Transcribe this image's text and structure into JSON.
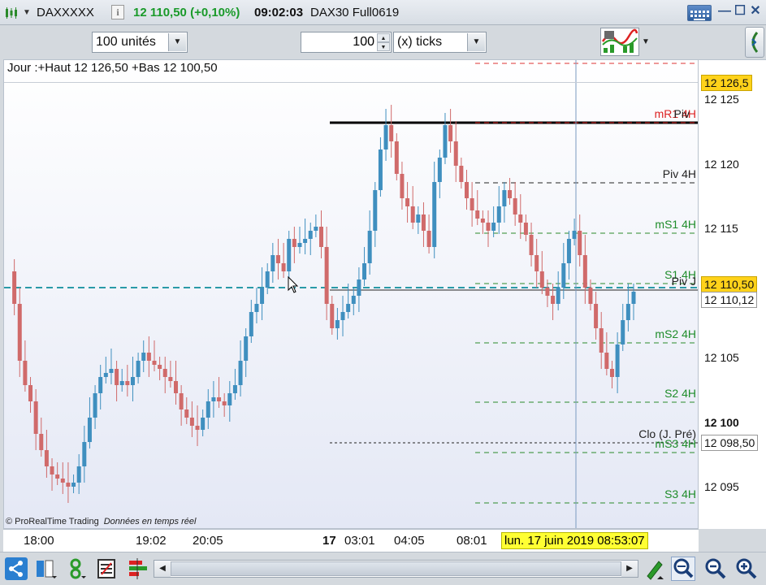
{
  "titlebar": {
    "symbol": "DAXXXXX",
    "info_label": "i",
    "price_change": "12 110,50 (+0,10%)",
    "time": "09:02:03",
    "instrument": "DAX30 Full0619",
    "minimize": "—",
    "maximize": "☐",
    "close": "✕"
  },
  "toolbar": {
    "units_select": "100 unités",
    "quantity": "100",
    "ticks_select": "(x) ticks"
  },
  "chart": {
    "header": "Jour :+Haut 12 126,50 +Bas 12 100,50",
    "credit_brand": "© ProRealTime Trading",
    "credit_note": "Données en temps réel",
    "levels": {
      "mr1": "mR1 4H",
      "piv": "Piv",
      "piv4h": "Piv 4H",
      "ms1": "mS1 4H",
      "s1": "S1 4H",
      "piv_j": "Piv J",
      "ms2": "mS2 4H",
      "s2": "S2 4H",
      "clo": "Clo (J. Pré)",
      "ms3": "mS3 4H",
      "s3": "S3 4H"
    },
    "colors": {
      "up": "#3f8fbf",
      "down": "#d06a6a",
      "green_level": "#1e8c2a",
      "red_level": "#dd2222"
    }
  },
  "yaxis": {
    "ticks": [
      "12 125",
      "12 120",
      "12 115",
      "12 105",
      "12 095"
    ],
    "bold_tick": "12 100",
    "high_tag": "12 126,5",
    "last_tag": "12 110,50",
    "cursor_tag": "12 110,12",
    "close_tag": "12 098,50"
  },
  "xaxis": {
    "ticks": [
      "18:00",
      "19:02",
      "20:05",
      "03:01",
      "04:05",
      "08:01"
    ],
    "day": "17",
    "cursor_label": "lun. 17 juin 2019 08:53:07"
  },
  "bottombar": {
    "icons": [
      "share-icon",
      "layout-icon",
      "indicator-icon",
      "list-icon",
      "bars-icon",
      "drawing-tools-icon",
      "zoom-active-icon",
      "zoom-out-icon",
      "zoom-in-icon"
    ]
  }
}
